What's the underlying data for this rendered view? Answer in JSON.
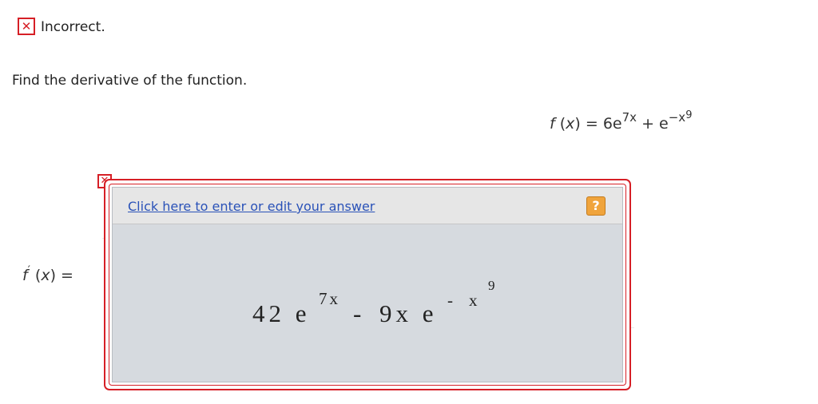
{
  "status": {
    "icon": "close-icon",
    "glyph": "✕",
    "text": "Incorrect."
  },
  "question": {
    "prompt": "Find the derivative of the function."
  },
  "function": {
    "f": "f",
    "open": " (",
    "var": "x",
    "close": ") = 6e",
    "exp1": "7x",
    "plus": " + e",
    "exp2": "−x",
    "exp2pow": "9"
  },
  "derivative": {
    "f": "f",
    "prime": "′",
    "rest": "(x) =",
    "open": " (",
    "var": "x",
    "close": ") ="
  },
  "answer": {
    "edit_link": "Click here to enter or edit your answer",
    "help_label": "?",
    "help_icon": "question-mark-icon",
    "error_icon": "close-icon",
    "error_glyph": "✕",
    "expr": {
      "coef": "42 e",
      "exp1": "7x",
      "minus": "-",
      "term2": "9x e",
      "exp2_minus": "-",
      "exp2_x": "x",
      "exp2_pow": "9"
    }
  },
  "colors": {
    "error": "#d61f26",
    "link": "#2a52b8",
    "help": "#f0a43c",
    "panel": "#d6dadf"
  }
}
